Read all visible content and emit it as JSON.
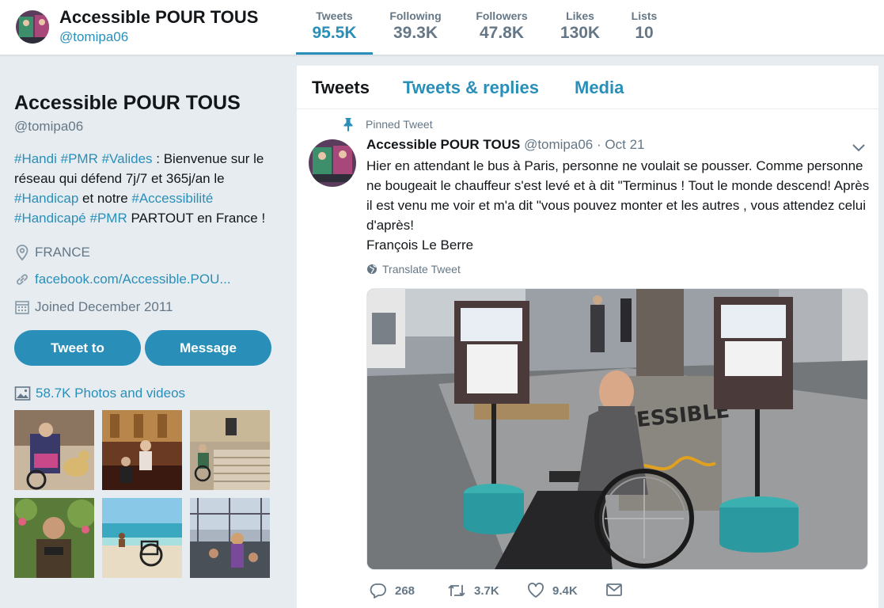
{
  "profile": {
    "name": "Accessible POUR TOUS",
    "handle": "@tomipa06",
    "bio": {
      "ht1": "#Handi",
      "ht2": "#PMR",
      "ht3": "#Valides",
      "t1": " : Bienvenue sur le réseau qui défend 7j/7 et 365j/an le ",
      "ht4": "#Handicap",
      "t2": " et notre ",
      "ht5": "#Accessibilité",
      "ht6": "#Handicapé",
      "ht7": "#PMR",
      "t3": " PARTOUT en France !"
    },
    "location": "FRANCE",
    "website": "facebook.com/Accessible.POU...",
    "joined": "Joined December 2011",
    "tweet_to_label": "Tweet to",
    "message_label": "Message",
    "photos_label": "58.7K Photos and videos"
  },
  "stats": [
    {
      "label": "Tweets",
      "value": "95.5K",
      "active": true
    },
    {
      "label": "Following",
      "value": "39.3K"
    },
    {
      "label": "Followers",
      "value": "47.8K"
    },
    {
      "label": "Likes",
      "value": "130K"
    },
    {
      "label": "Lists",
      "value": "10"
    }
  ],
  "tabs": [
    {
      "label": "Tweets",
      "active": true
    },
    {
      "label": "Tweets & replies"
    },
    {
      "label": "Media"
    }
  ],
  "tweet": {
    "pinned_label": "Pinned Tweet",
    "author": "Accessible POUR TOUS",
    "handle": "@tomipa06",
    "separator": "·",
    "date": "Oct 21",
    "lines": [
      "Hier en attendant le bus à Paris, personne ne voulait se pousser. Comme personne ne bougeait le chauffeur s'est levé et à dit \"Terminus ! Tout le monde descend! Après il est venu me voir et m'a dit \"vous pouvez monter et les autres , vous attendez celui d'après!",
      "François Le Berre"
    ],
    "translate_label": "Translate Tweet",
    "media_sign_text": "ESSIBLE",
    "replies": "268",
    "retweets": "3.7K",
    "likes": "9.4K"
  },
  "colors": {
    "accent": "#2a8fb8",
    "background": "#e6ecf0",
    "muted": "#657786"
  },
  "icons": [
    "pin-icon",
    "caret-down-icon",
    "globe-icon",
    "reply-icon",
    "retweet-icon",
    "heart-icon",
    "mail-icon",
    "location-icon",
    "link-icon",
    "calendar-icon",
    "photo-icon"
  ]
}
